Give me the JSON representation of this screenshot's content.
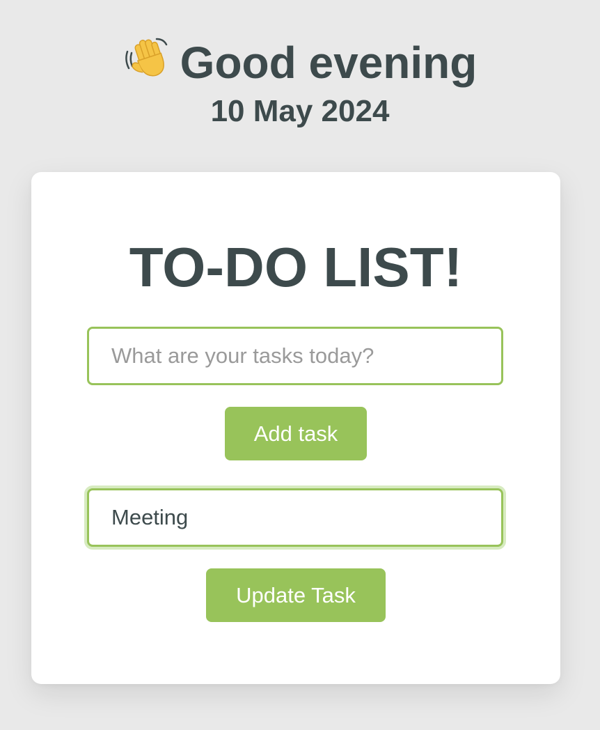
{
  "header": {
    "wave_emoji": "👋",
    "greeting": "Good evening",
    "date": "10 May 2024"
  },
  "card": {
    "title": "TO-DO LIST!",
    "task_input": {
      "placeholder": "What are your tasks today?",
      "value": ""
    },
    "add_button_label": "Add task",
    "edit_input": {
      "value": "Meeting"
    },
    "update_button_label": "Update Task"
  },
  "colors": {
    "accent": "#98c35a",
    "text": "#3d4a4c",
    "background": "#e9e9e9",
    "card": "#ffffff",
    "focus_ring": "#d7ebc0"
  }
}
